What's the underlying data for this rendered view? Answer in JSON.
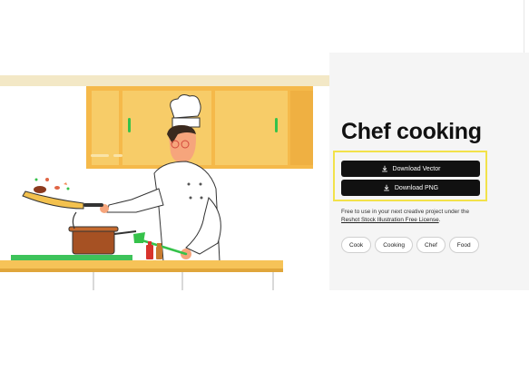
{
  "header": {},
  "illustration": {
    "alt_label": "Chef cooking illustration"
  },
  "panel": {
    "title": "Chef cooking",
    "download_vector_label": "Download Vector",
    "download_png_label": "Download PNG",
    "license_prefix": "Free to use in your next creative project under the",
    "license_link": "Reshot Stock Illustration Free License",
    "license_suffix": ".",
    "tags": [
      "Cook",
      "Cooking",
      "Chef",
      "Food"
    ]
  },
  "colors": {
    "highlight": "#f2e24a",
    "button_bg": "#111111",
    "cabinet": "#f7c85a",
    "counter": "#f6c358",
    "cutting_board": "#3ec35a",
    "pot": "#a0522d"
  },
  "icons": [
    "download-icon"
  ]
}
